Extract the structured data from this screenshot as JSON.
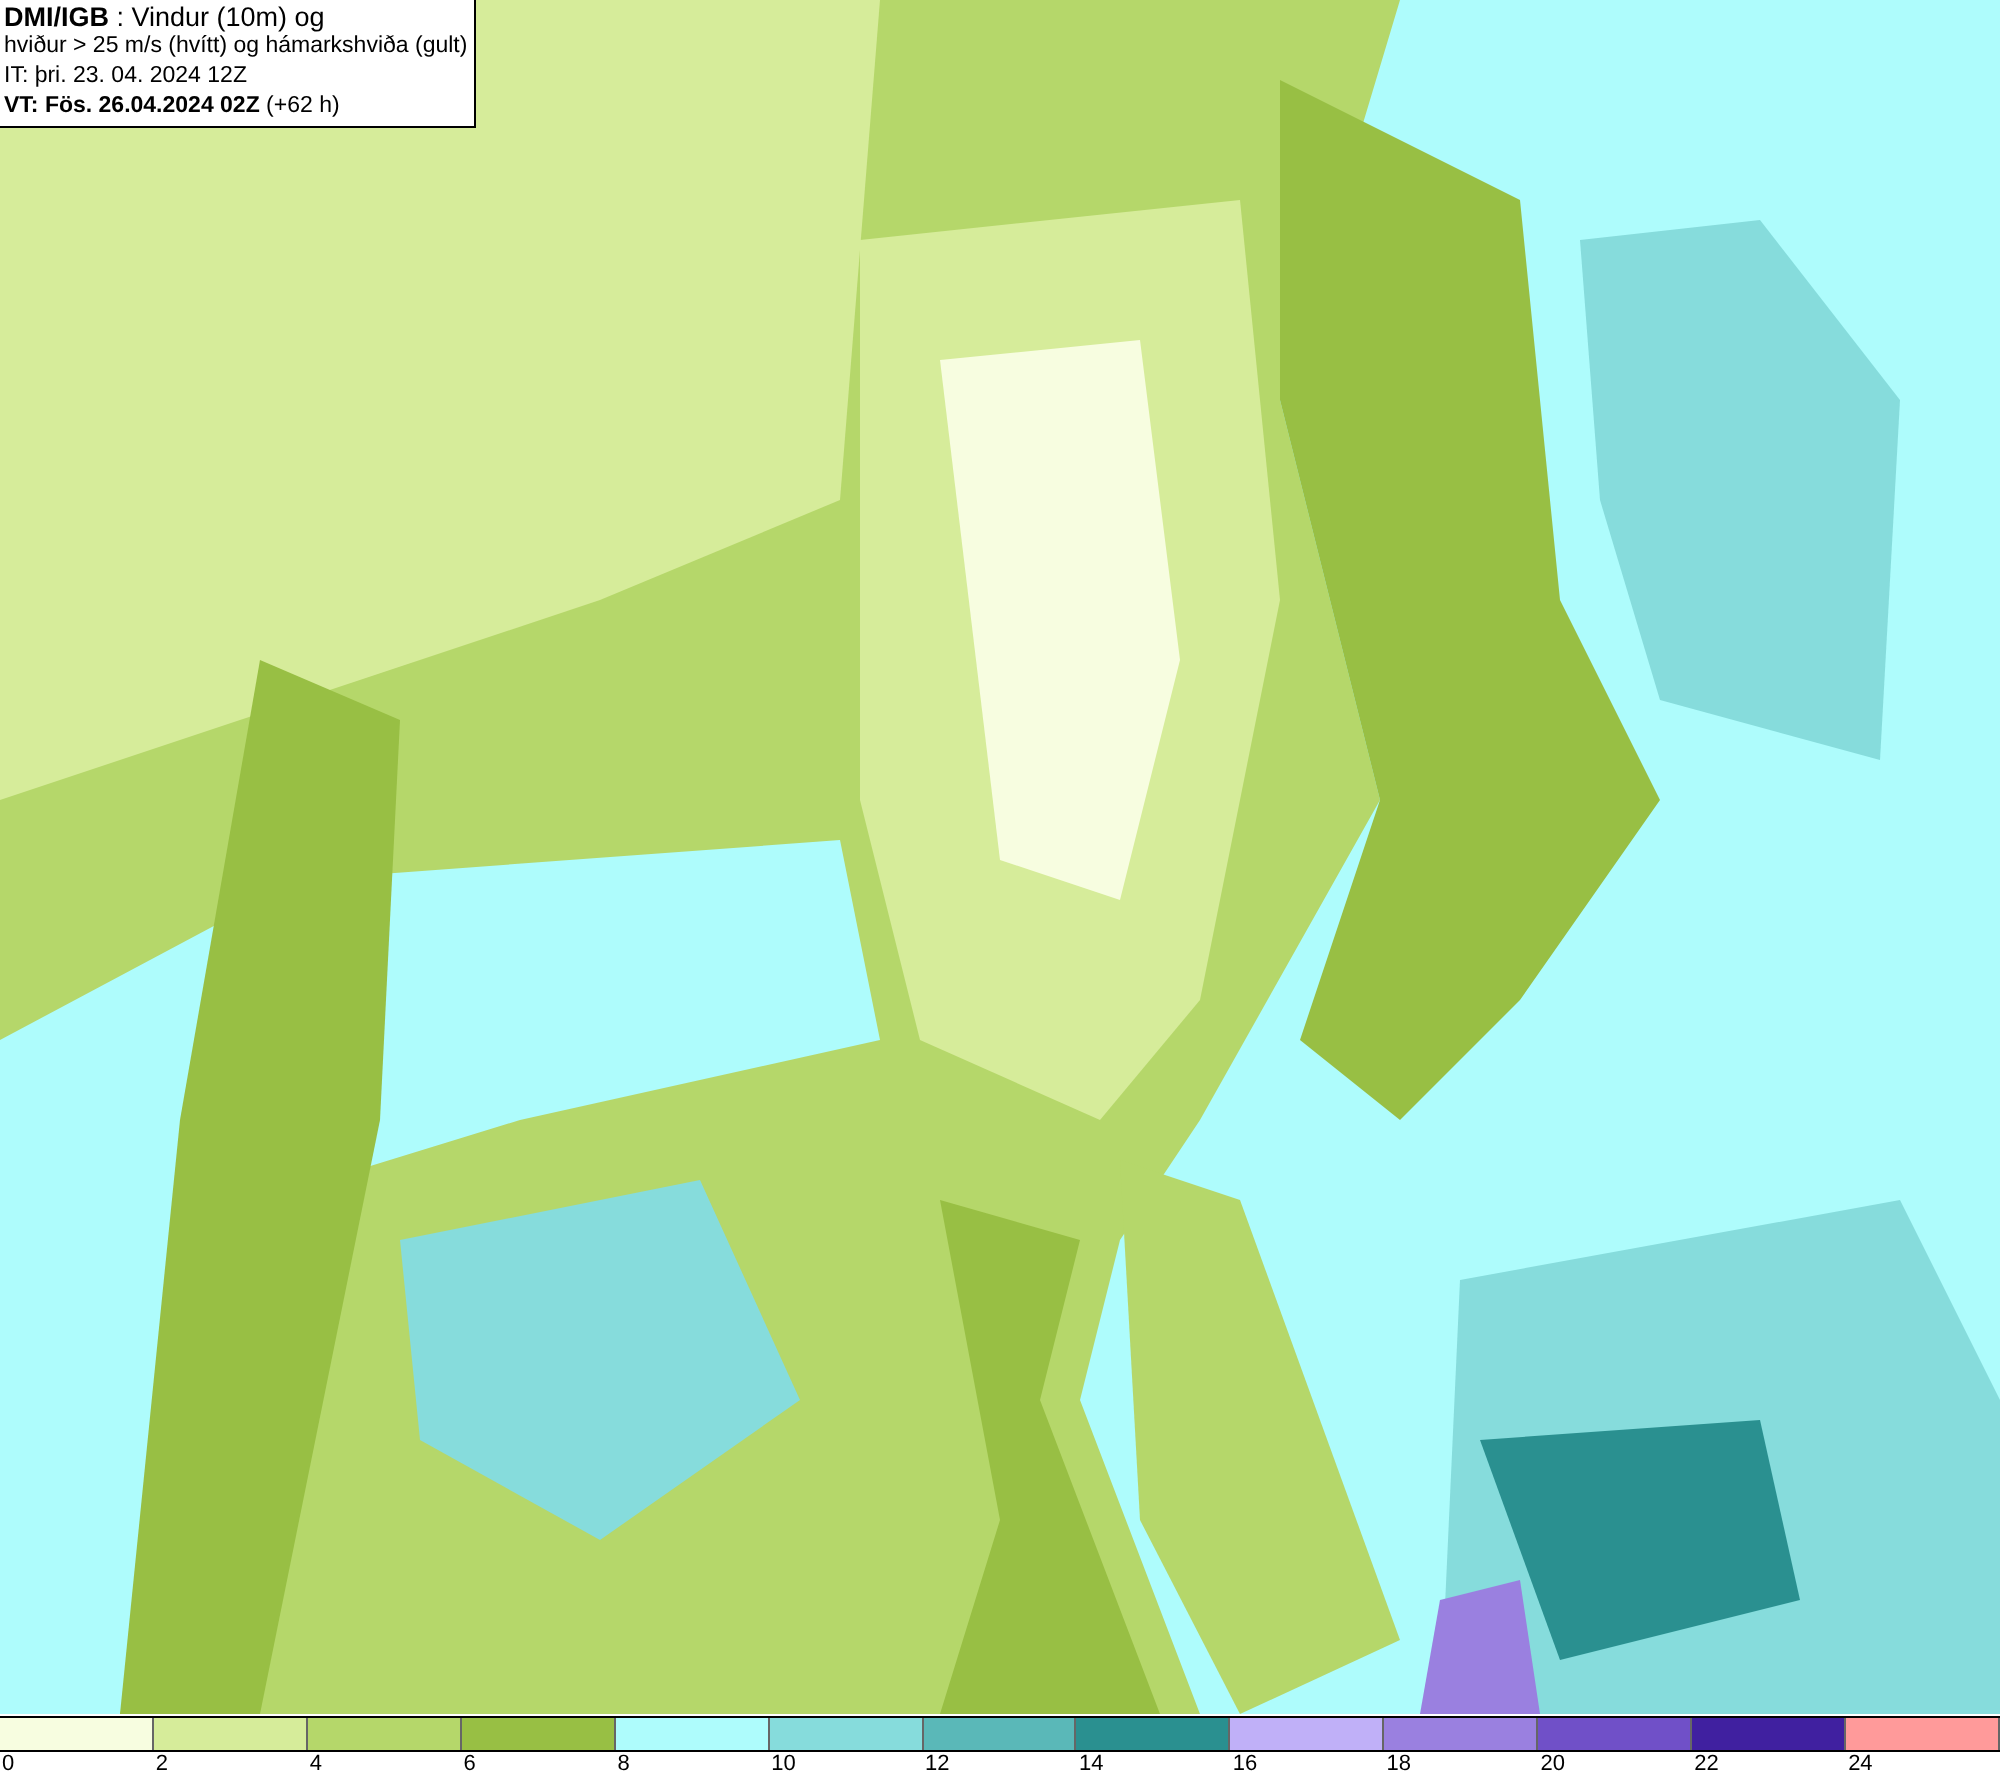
{
  "title_box": {
    "lines": [
      "**DMI/IGB** : Vindur (10m) og",
      "hviður > 25 m/s (hvítt) og hámarkshviða (gult)",
      "IT: þri. 23. 04. 2024 12Z",
      "**VT: Fös. 26.04.2024 02Z** (+62 h)"
    ]
  },
  "legend": [
    {
      "label": "0",
      "color": "#f7fde0"
    },
    {
      "label": "2",
      "color": "#d6ec9a"
    },
    {
      "label": "4",
      "color": "#b5d76a"
    },
    {
      "label": "6",
      "color": "#98bf44"
    },
    {
      "label": "8",
      "color": "#aefcfc"
    },
    {
      "label": "10",
      "color": "#86dcdc"
    },
    {
      "label": "12",
      "color": "#5ab8b8"
    },
    {
      "label": "14",
      "color": "#2a9090"
    },
    {
      "label": "16",
      "color": "#c0b0f8"
    },
    {
      "label": "18",
      "color": "#9a80e0"
    },
    {
      "label": "20",
      "color": "#7050c8"
    },
    {
      "label": "22",
      "color": "#4020a0"
    },
    {
      "label": "24",
      "color": "#ff9a9a"
    }
  ]
}
